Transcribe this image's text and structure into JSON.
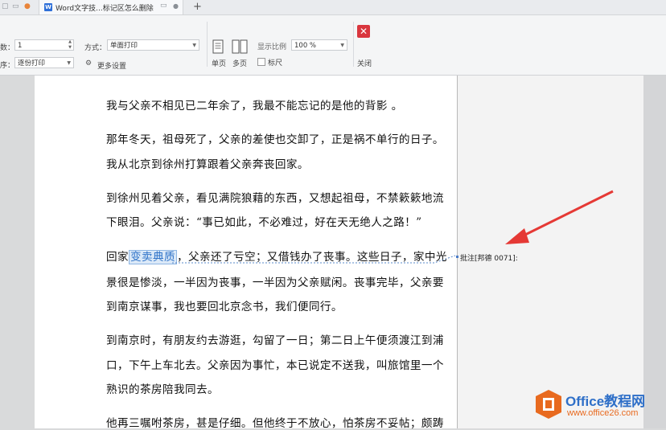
{
  "tabbar": {
    "doc_tab_title": "Word文字技...标记区怎么删除",
    "doc_badge": "W",
    "new_tab": "+"
  },
  "toolbar": {
    "copies_label": "数：",
    "copies_value": "1",
    "order_label": "序：",
    "order_value": "逐份打印",
    "mode_label": "方式：",
    "mode_value": "单面打印",
    "more_settings": "更多设置",
    "single_page": "单页",
    "multi_page": "多页",
    "zoom_label": "显示比例",
    "zoom_value": "100 %",
    "ruler_label": "标尺",
    "close_label": "关闭"
  },
  "document": {
    "paragraphs": [
      "我与父亲不相见已二年余了，我最不能忘记的是他的背影 。",
      "那年冬天，祖母死了，父亲的差使也交卸了，正是祸不单行的日子。",
      "我从北京到徐州打算跟着父亲奔丧回家。",
      "到徐州见着父亲，看见满院狼藉的东西，又想起祖母，不禁簌簌地流",
      "下眼泪。父亲说：“事已如此，不必难过，好在天无绝人之路！”",
      "景很是惨淡，一半因为丧事，一半因为父亲赋闲。丧事完毕，父亲要",
      "到南京谋事，我也要回北京念书，我们便同行。",
      "到南京时，有朋友约去游逛，勾留了一日；第二日上午便须渡江到浦",
      "口，下午上车北去。父亲因为事忙，本已说定不送我，叫旅馆里一个",
      "熟识的茶房陪我同去。",
      "他再三嘱咐茶房，甚是仔细。但他终于不放心，怕茶房不妥帖；颇踌"
    ],
    "highlight_line": {
      "before": "回家",
      "highlighted": "变卖典质",
      "after": "，父亲还了亏空；又借钱办了丧事。这些日子，家中光"
    }
  },
  "comment": {
    "label": "批注[邦德 0071]:"
  },
  "watermark": {
    "brand": "Office教程网",
    "url": "www.office26.com"
  }
}
